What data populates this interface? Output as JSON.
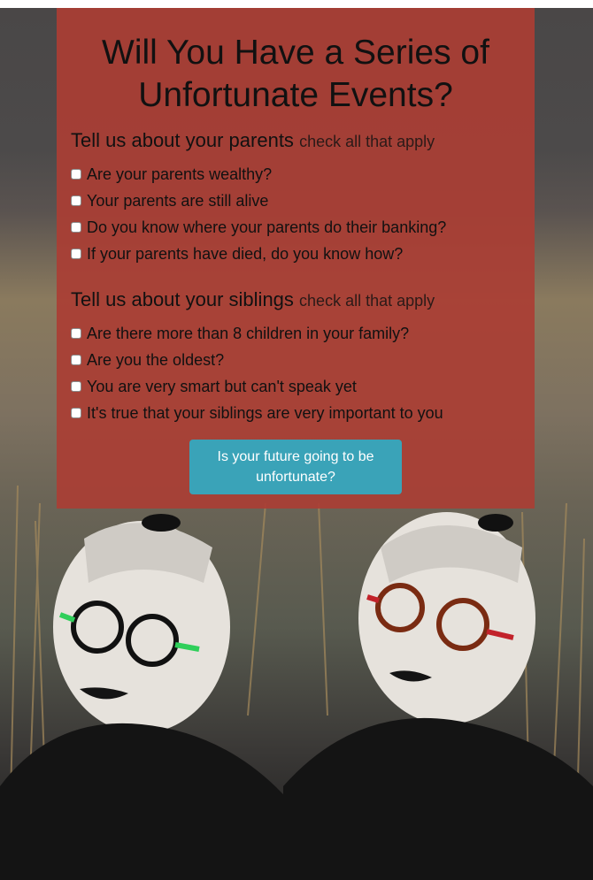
{
  "page": {
    "title": "Will You Have a Series of Unfortunate Events?"
  },
  "parents": {
    "heading": "Tell us about your parents",
    "hint": "check all that apply",
    "options": [
      "Are your parents wealthy?",
      "Your parents are still alive",
      "Do you know where your parents do their banking?",
      "If your parents have died, do you know how?"
    ]
  },
  "siblings": {
    "heading": "Tell us about your siblings",
    "hint": "check all that apply",
    "options": [
      "Are there more than 8 children in your family?",
      "Are you the oldest?",
      "You are very smart but can't speak yet",
      "It's true that your siblings are very important to you"
    ]
  },
  "submit_label": "Is your future going to be unfortunate?",
  "colors": {
    "card": "#aa3e34",
    "button": "#3aa3b8"
  },
  "background_image": "photo of two women with white face paint and round glasses"
}
